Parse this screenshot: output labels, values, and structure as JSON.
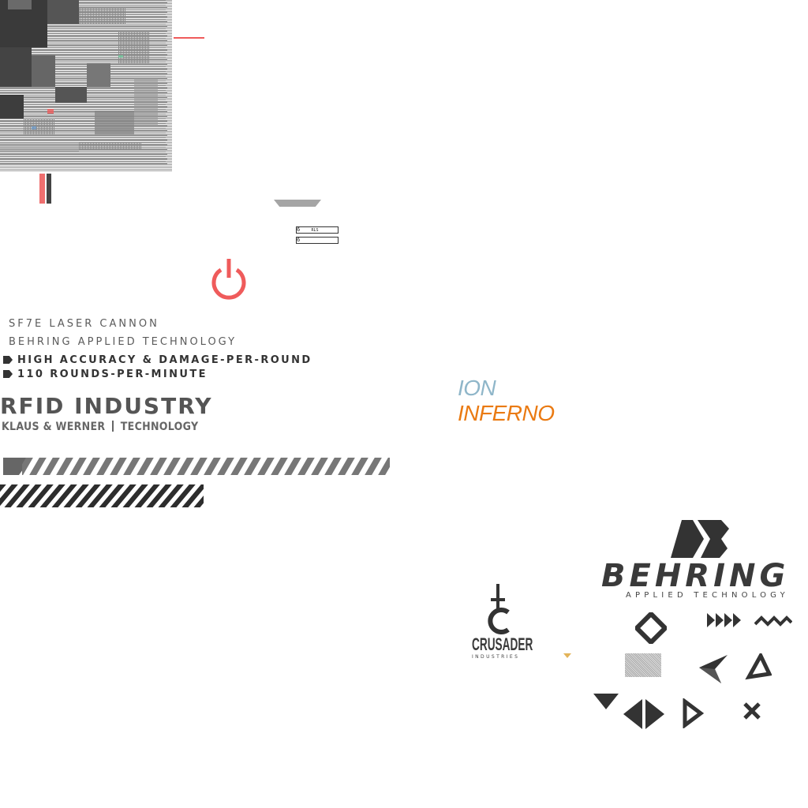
{
  "weapon": {
    "name": "SF7E LASER CANNON",
    "maker": "BEHRING APPLIED TECHNOLOGY",
    "features": [
      "HIGH ACCURACY & DAMAGE-PER-ROUND",
      "110 ROUNDS-PER-MINUTE"
    ]
  },
  "rfid": {
    "title": "RFID INDUSTRY",
    "company": "KLAUS & WERNER",
    "division": "TECHNOLOGY"
  },
  "damage_types": {
    "ion": "ION",
    "inferno": "INFERNO"
  },
  "gauges": [
    {
      "index": "6",
      "label": "RLS"
    },
    {
      "index": "6",
      "label": ""
    }
  ],
  "logos": {
    "behring": {
      "name": "BEHRING",
      "tagline": "APPLIED TECHNOLOGY"
    },
    "crusader": {
      "name": "CRUSADER",
      "tagline": "INDUSTRIES"
    }
  },
  "colors": {
    "accent_red": "#ef5b5b",
    "ion_blue": "#8fb6c9",
    "inferno_orange": "#ea7a12",
    "dark_gray": "#333333",
    "mid_gray": "#777777",
    "marker_yellow": "#e3b45a"
  },
  "icons": [
    "power-icon",
    "diamond-icon",
    "fast-forward-icon",
    "zigzag-icon",
    "bowtie-icon",
    "triangle-outline-icon",
    "triangle-down-icon",
    "left-right-arrows-icon",
    "play-outline-icon",
    "close-icon"
  ]
}
